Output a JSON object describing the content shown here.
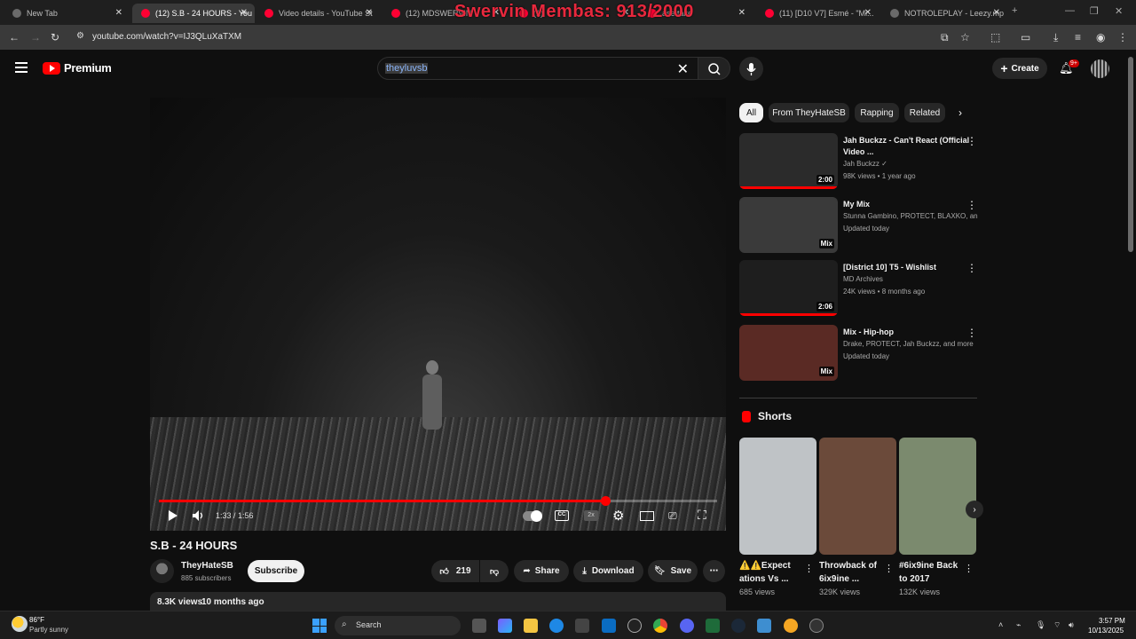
{
  "overlay_title": "Swervin Membas: 913/2000",
  "browser": {
    "tabs": [
      {
        "label": "New Tab",
        "fav": "#6a6a6a"
      },
      {
        "label": "(12) S.B - 24 HOURS - You",
        "fav": "#ff0033"
      },
      {
        "label": "Video details - YouTube St",
        "fav": "#ff0033"
      },
      {
        "label": "(12) MDSWERVIN",
        "fav": "#ff0033"
      },
      {
        "label": "(1)",
        "fav": "#ff0033"
      },
      {
        "label": "ase take",
        "fav": "#ff0033"
      },
      {
        "label": "(11) [D10 V7] Esmé - \"Mi...",
        "fav": "#ff0033"
      },
      {
        "label": "NOTROLEPLAY - Leezy.mp",
        "fav": "#6a6a6a"
      }
    ],
    "url": "youtube.com/watch?v=IJ3QLuXaTXM"
  },
  "header": {
    "logo_text": "Premium",
    "search_value": "theyluvsb",
    "create_label": "Create",
    "notif_badge": "9+"
  },
  "player": {
    "time": "1:33 / 1:56",
    "progress": 0.8,
    "speed_label": "2x",
    "cc_label": "CC"
  },
  "video": {
    "title": "S.B - 24 HOURS",
    "channel": "TheyHateSB",
    "subs": "885 subscribers",
    "subscribe_label": "Subscribe",
    "likes": "219",
    "share_label": "Share",
    "download_label": "Download",
    "save_label": "Save",
    "views": "8.3K views",
    "age": "10 months ago"
  },
  "chips": [
    "All",
    "From TheyHateSB",
    "Rapping",
    "Related"
  ],
  "recs": [
    {
      "title": "Jah Buckzz - Can't React (Official Video ...",
      "meta1": "Jah Buckzz ✓",
      "meta2": "98K views • 1 year ago",
      "duration": "2:00",
      "watched": 1.0,
      "thumb_bg": "#2b2b2b"
    },
    {
      "title": "My Mix",
      "meta1": "Stunna Gambino, PROTECT, BLAXKO, an...",
      "meta2": "Updated today",
      "duration": "Mix",
      "watched": 0,
      "thumb_bg": "#3a3a3a"
    },
    {
      "title": "[District 10] T5 - Wishlist",
      "meta1": "MD Archives",
      "meta2": "24K views • 8 months ago",
      "duration": "2:06",
      "watched": 1.0,
      "thumb_bg": "#1e1e1e"
    },
    {
      "title": "Mix - Hip-hop",
      "meta1": "Drake, PROTECT, Jah Buckzz, and more",
      "meta2": "Updated today",
      "duration": "Mix",
      "watched": 0,
      "thumb_bg": "#5a2a24"
    }
  ],
  "shorts": {
    "heading": "Shorts",
    "items": [
      {
        "title": "⚠️⚠️Expect ations Vs ...",
        "views": "685 views",
        "bg": "#bfc3c6"
      },
      {
        "title": "Throwback of 6ix9ine ...",
        "views": "329K views",
        "bg": "#6b4a3a"
      },
      {
        "title": "#6ix9ine Back to 2017",
        "views": "132K views",
        "bg": "#7b8a6e"
      }
    ]
  },
  "taskbar": {
    "temp": "86°F",
    "weather": "Partly sunny",
    "search_label": "Search",
    "time": "3:57 PM",
    "date": "10/13/2025"
  }
}
